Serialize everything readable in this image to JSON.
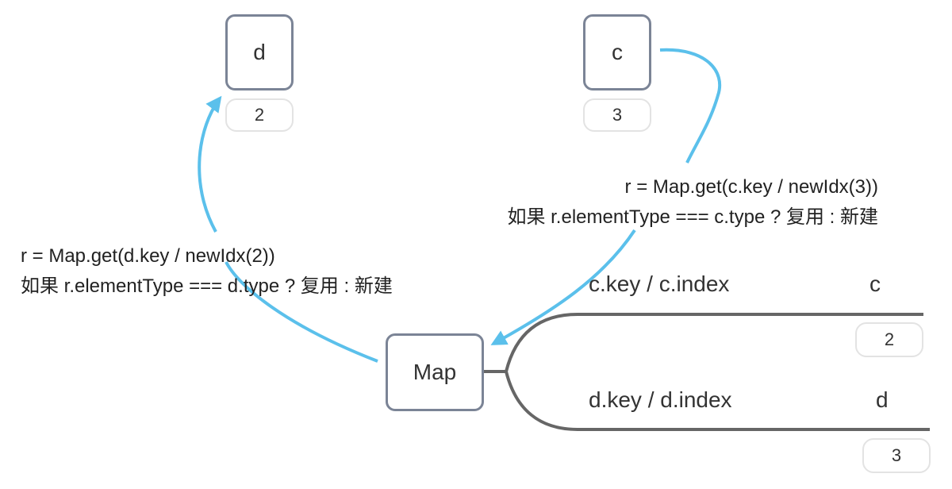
{
  "nodes": {
    "d": {
      "label": "d",
      "badge": "2"
    },
    "c": {
      "label": "c",
      "badge": "3"
    },
    "map": {
      "label": "Map"
    }
  },
  "notes": {
    "c": {
      "line1": "r = Map.get(c.key / newIdx(3))",
      "line2": "如果 r.elementType === c.type ? 复用 : 新建"
    },
    "d": {
      "line1": "r = Map.get(d.key / newIdx(2))",
      "line2": "如果 r.elementType === d.type ? 复用 : 新建"
    }
  },
  "map_entries": [
    {
      "key_label": "c.key / c.index",
      "value": "c",
      "index": "2"
    },
    {
      "key_label": "d.key / d.index",
      "value": "d",
      "index": "3"
    }
  ],
  "colors": {
    "arrow": "#5bc0eb",
    "node_border": "#7b8496",
    "branch": "#666666",
    "pill_border": "#e3e3e3"
  }
}
